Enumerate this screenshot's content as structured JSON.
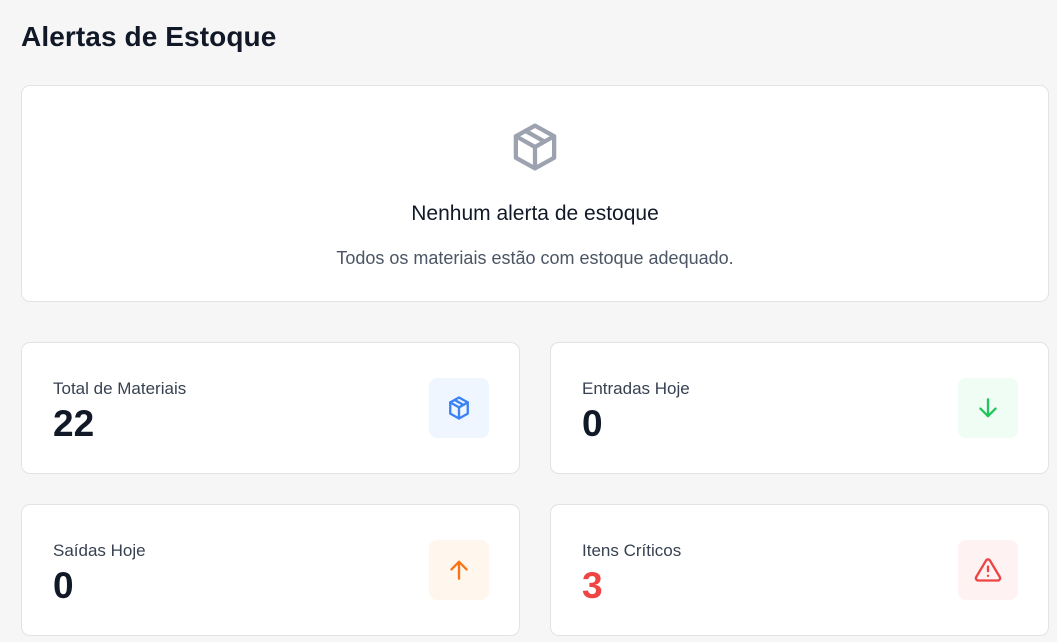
{
  "page": {
    "title": "Alertas de Estoque"
  },
  "empty_state": {
    "icon": "package-icon",
    "title": "Nenhum alerta de estoque",
    "description": "Todos os materiais estão com estoque adequado."
  },
  "stats": [
    {
      "label": "Total de Materiais",
      "value": "22",
      "icon": "package-icon",
      "icon_color": "#3b82f6",
      "icon_bg": "#eff6ff"
    },
    {
      "label": "Entradas Hoje",
      "value": "0",
      "icon": "arrow-down-icon",
      "icon_color": "#22c55e",
      "icon_bg": "#f0fdf4"
    },
    {
      "label": "Saídas Hoje",
      "value": "0",
      "icon": "arrow-up-icon",
      "icon_color": "#f97316",
      "icon_bg": "#fff7ed"
    },
    {
      "label": "Itens Críticos",
      "value": "3",
      "value_color": "#ef4444",
      "icon": "alert-triangle-icon",
      "icon_color": "#ef4444",
      "icon_bg": "#fef2f2"
    }
  ],
  "colors": {
    "background": "#f6f6f7",
    "card": "#ffffff",
    "text_primary": "#111827",
    "text_secondary": "#4b5563"
  }
}
